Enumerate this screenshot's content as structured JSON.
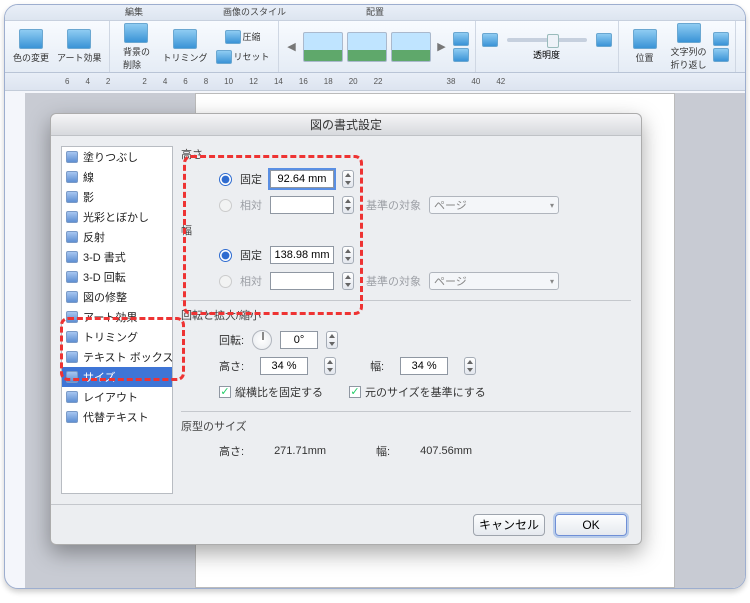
{
  "ribbon_tabs": {
    "a": "編集",
    "b": "画像のスタイル",
    "c": "配置"
  },
  "ribbon": {
    "recolor": "色の変更",
    "art_effects": "アート効果",
    "bg_remove": "背景の\n削除",
    "crop": "トリミング",
    "compress": "圧縮",
    "reset": "リセット",
    "transparency": "透明度",
    "position": "位置",
    "wrap": "文字列の\n折り返し"
  },
  "ruler_marks": [
    "6",
    "4",
    "2",
    "",
    "2",
    "4",
    "6",
    "8",
    "10",
    "12",
    "14",
    "16",
    "18",
    "20",
    "22",
    "",
    "",
    "",
    "38",
    "40",
    "42"
  ],
  "dialog": {
    "title": "図の書式設定",
    "sidebar": [
      "塗りつぶし",
      "線",
      "影",
      "光彩とぼかし",
      "反射",
      "3-D 書式",
      "3-D 回転",
      "図の修整",
      "アート効果",
      "トリミング",
      "テキスト ボックス",
      "サイズ",
      "レイアウト",
      "代替テキスト"
    ],
    "selected_index": 11,
    "sections": {
      "height": "高さ",
      "width": "幅",
      "rotate_scale": "回転と拡大/縮小",
      "original": "原型のサイズ"
    },
    "labels": {
      "fixed": "固定",
      "relative": "相対",
      "base": "基準の対象",
      "page": "ページ",
      "rotation": "回転:",
      "height_s": "高さ:",
      "width_s": "幅:",
      "lock_aspect": "縦横比を固定する",
      "use_original": "元のサイズを基準にする"
    },
    "values": {
      "height_fixed": "92.64 mm",
      "width_fixed": "138.98 mm",
      "rotation": "0°",
      "scale_h": "34 %",
      "scale_w": "34 %",
      "orig_h": "271.71mm",
      "orig_w": "407.56mm"
    },
    "buttons": {
      "cancel": "キャンセル",
      "ok": "OK"
    }
  }
}
